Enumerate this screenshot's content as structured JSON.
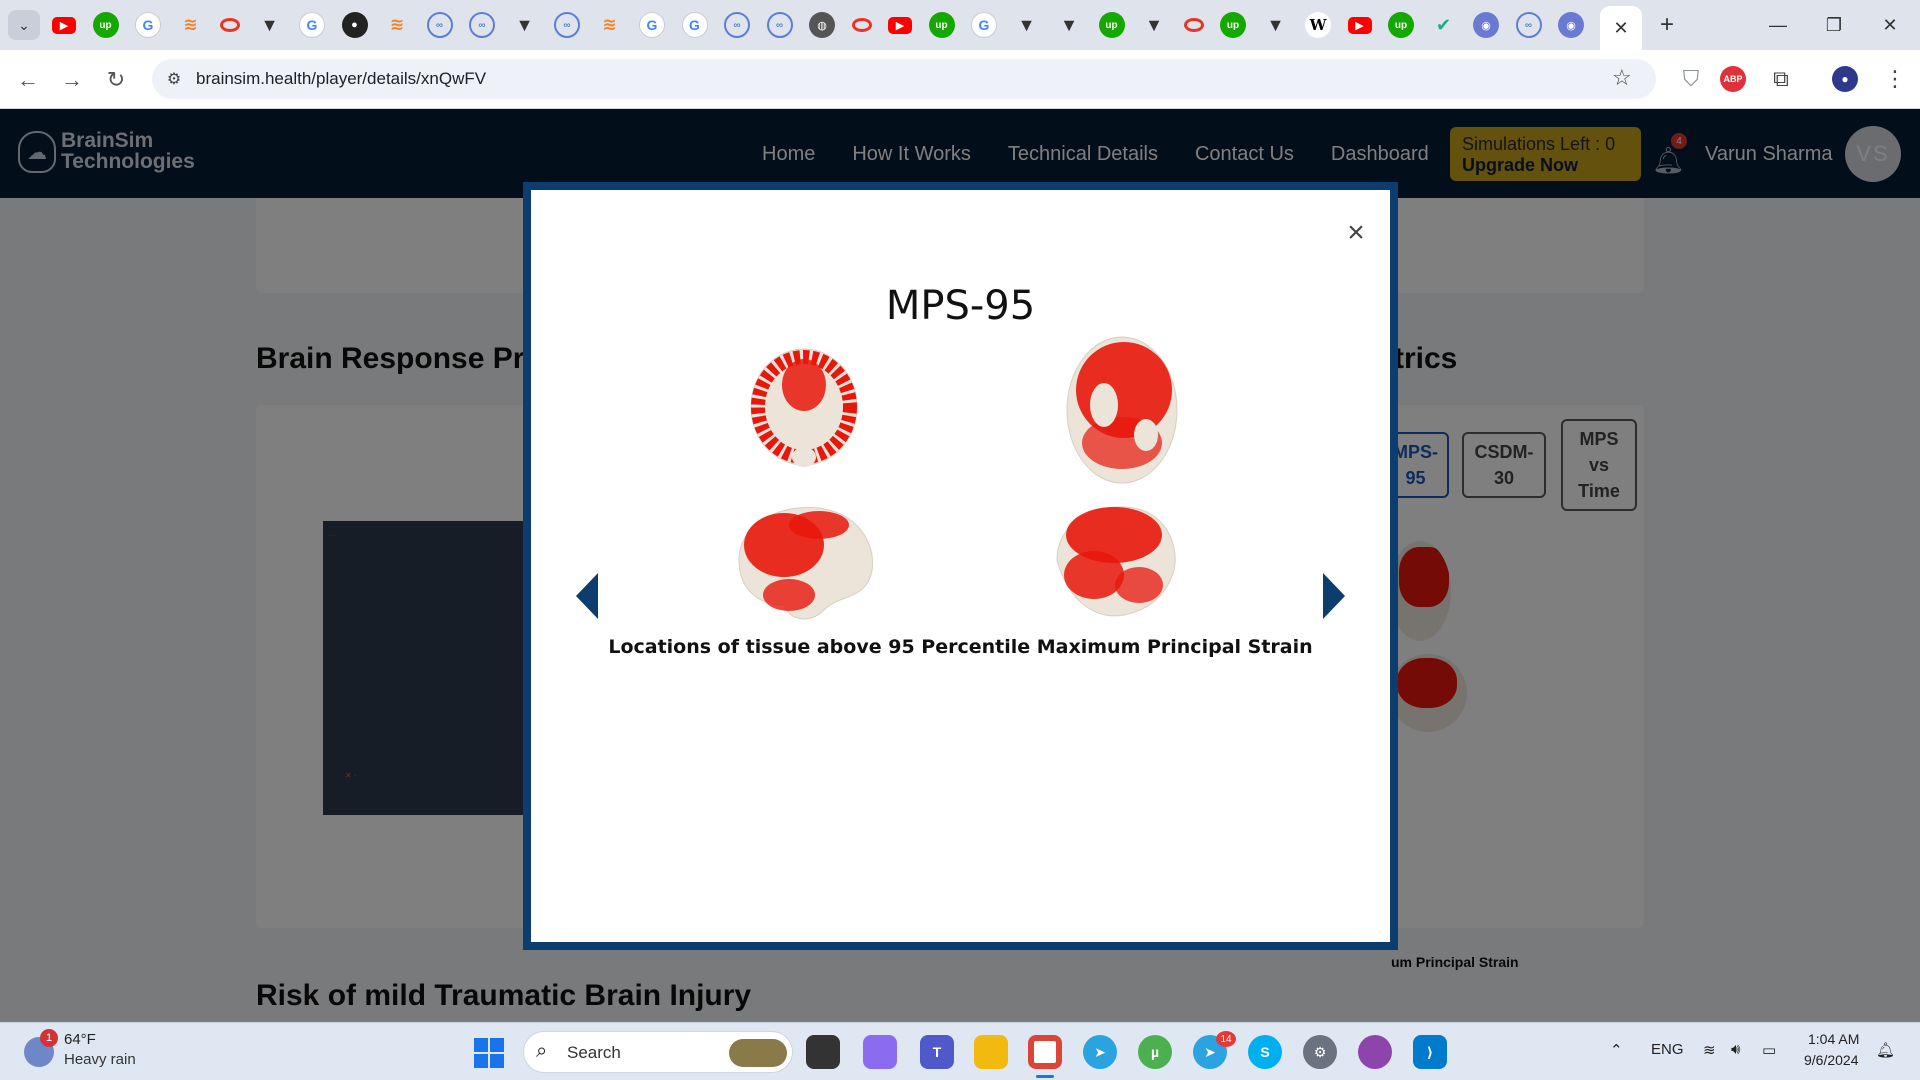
{
  "browser": {
    "tab_dropdown": "⌄",
    "active_tab_close": "✕",
    "new_tab": "+",
    "favicons": [
      "yt",
      "up",
      "g",
      "so",
      "op",
      "pl",
      "g",
      "gh",
      "so",
      "cl",
      "cl",
      "pl",
      "cl",
      "so",
      "g",
      "g",
      "cl",
      "cl",
      "gl",
      "op",
      "yt",
      "up",
      "g",
      "pl",
      "pl",
      "up",
      "pl",
      "op",
      "up",
      "pl",
      "w",
      "yt",
      "up",
      "ck",
      "ai",
      "cl",
      "ai"
    ],
    "window_controls": {
      "minimize": "—",
      "restore": "❐",
      "close": "✕"
    },
    "nav": {
      "back": "←",
      "forward": "→",
      "reload": "↻"
    },
    "url": "brainsim.health/player/details/xnQwFV",
    "site_info_icon": "tune-icon",
    "star": "☆",
    "extensions": {
      "shield": "⛉",
      "abp": "ABP",
      "puzzle": "⧉",
      "profile": "●",
      "menu": "⋮"
    }
  },
  "header": {
    "logo_line1": "BrainSim",
    "logo_line2": "Technologies",
    "nav": [
      "Home",
      "How It Works",
      "Technical Details",
      "Contact Us",
      "Dashboard"
    ],
    "simulations_left": "Simulations Left : 0",
    "upgrade": "Upgrade Now",
    "notification_count": "4",
    "user_name": "Varun Sharma",
    "user_initials": "VS"
  },
  "page": {
    "brain_response_title": "Brain Response Pr",
    "metrics_title_suffix": "trics",
    "tabs": [
      {
        "label": "MPS-\n95",
        "active": true
      },
      {
        "label": "CSDM-\n30",
        "active": false
      },
      {
        "label": "MPS\nvs\nTime",
        "active": false
      }
    ],
    "bg_caption": "um Principal Strain",
    "risk_title": "Risk of mild Traumatic Brain Injury"
  },
  "modal": {
    "title": "MPS-95",
    "caption": "Locations of tissue above 95 Percentile Maximum Principal Strain",
    "close": "×"
  },
  "taskbar": {
    "weather_badge": "1",
    "temperature": "64°F",
    "weather_desc": "Heavy rain",
    "search_label": "Search",
    "language": "ENG",
    "time": "1:04 AM",
    "date": "9/6/2024",
    "telegram_badge": "14"
  },
  "colors": {
    "header_bg": "#071d36",
    "modal_border": "#0d3c6e",
    "upgrade_bg": "#c9a31c",
    "strain_red": "#e8170c",
    "brain_tissue": "#eee6dc"
  }
}
